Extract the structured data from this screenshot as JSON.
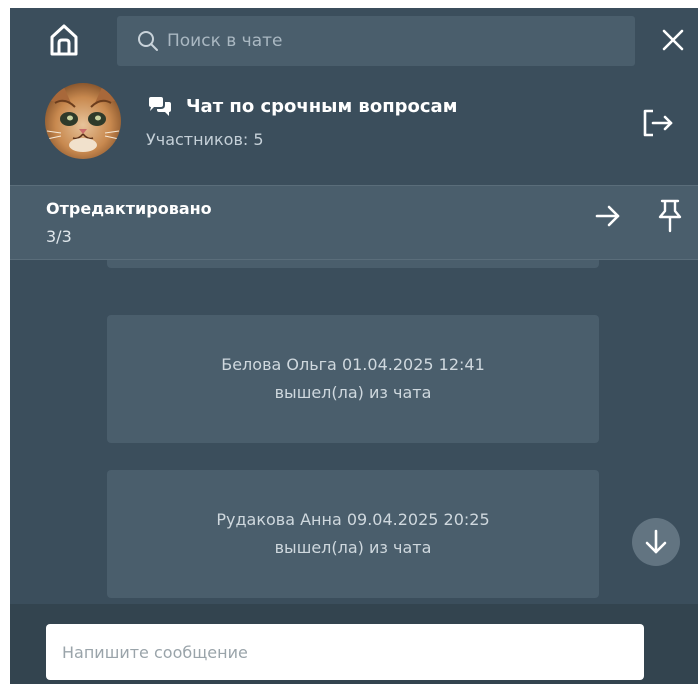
{
  "header": {
    "search_placeholder": "Поиск в чате"
  },
  "chat": {
    "title": "Чат по срочным вопросам",
    "participants": "Участников: 5"
  },
  "pinned": {
    "title": "Отредактировано",
    "count": "3/3"
  },
  "messages": [
    {
      "line1": "Белова Ольга 01.04.2025 12:41",
      "line2": "вышел(ла) из чата"
    },
    {
      "line1": "Рудакова Анна 09.04.2025 20:25",
      "line2": "вышел(ла) из чата"
    }
  ],
  "composer": {
    "placeholder": "Напишите сообщение"
  },
  "icons": {
    "home": "home-icon",
    "search": "search-icon",
    "close": "close-icon",
    "chat": "chat-bubbles-icon",
    "logout": "logout-icon",
    "next": "arrow-right-icon",
    "pin": "pin-icon",
    "scroll_down": "arrow-down-icon"
  },
  "colors": {
    "panel_bg": "#3b4e5c",
    "surface": "#4a5e6c",
    "composer_bg": "#33444f",
    "text_primary": "#ffffff",
    "text_secondary": "#c5d0d8"
  }
}
